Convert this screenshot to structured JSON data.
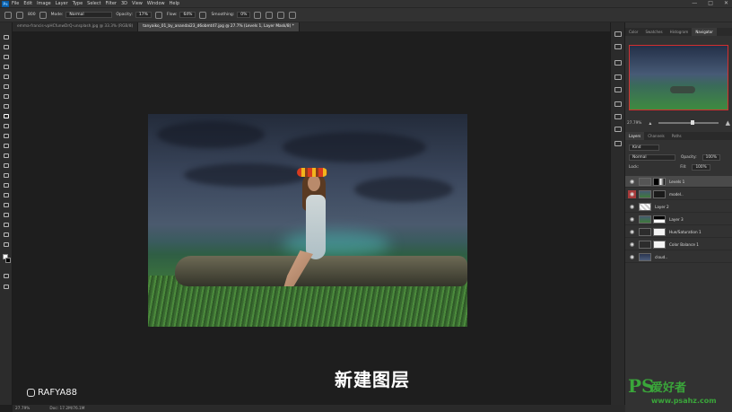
{
  "menubar": {
    "logo": "Ps",
    "items": [
      "File",
      "Edit",
      "Image",
      "Layer",
      "Type",
      "Select",
      "Filter",
      "3D",
      "View",
      "Window",
      "Help"
    ],
    "window_controls": [
      "—",
      "□",
      "✕"
    ]
  },
  "options": {
    "brush_size": "800",
    "mode_label": "Mode:",
    "mode_value": "Normal",
    "opacity_label": "Opacity:",
    "opacity_value": "17%",
    "flow_label": "Flow:",
    "flow_value": "64%",
    "smoothing_label": "Smoothing:",
    "smoothing_value": "0%"
  },
  "tabs": [
    {
      "label": "emma-francis-vpHCfunwDrQ-unsplash.jpg @ 33.3% (RGB/8)",
      "active": false
    },
    {
      "label": "tanyaiko_01_by_anandai23_d6obmt47.jpg @ 27.7% (Levels 1, Layer Mask/8) *",
      "active": true
    }
  ],
  "subtitle": "新建图层",
  "brand": {
    "handle": "RAFYA88"
  },
  "status": {
    "zoom": "27.79%",
    "doc": "Doc: 17.2M/76.1M"
  },
  "panels": {
    "top_tabs": [
      {
        "label": "Color",
        "active": false
      },
      {
        "label": "Swatches",
        "active": false
      },
      {
        "label": "Histogram",
        "active": false
      },
      {
        "label": "Navigator",
        "active": true
      }
    ],
    "nav_zoom": "27.79%",
    "layer_tabs": [
      {
        "label": "Layers",
        "active": true
      },
      {
        "label": "Channels",
        "active": false
      },
      {
        "label": "Paths",
        "active": false
      }
    ],
    "kind_label": "Kind",
    "blend_mode": "Normal",
    "opacity_label": "Opacity:",
    "opacity_value": "100%",
    "lock_label": "Lock:",
    "fill_label": "Fill:",
    "fill_value": "100%"
  },
  "layers": [
    {
      "name": "Levels 1",
      "selected": true,
      "visible_red": false
    },
    {
      "name": "model..",
      "selected": false,
      "visible_red": true
    },
    {
      "name": "Layer 2",
      "selected": false,
      "visible_red": false
    },
    {
      "name": "Layer 3",
      "selected": false,
      "visible_red": false
    },
    {
      "name": "Hue/Saturation 1",
      "selected": false,
      "visible_red": false
    },
    {
      "name": "Color Balance 1",
      "selected": false,
      "visible_red": false
    },
    {
      "name": "cloud..",
      "selected": false,
      "visible_red": false
    }
  ],
  "watermark": {
    "ps": "PS",
    "cn": "爱好者",
    "url": "www.psahz.com"
  },
  "colors": {
    "accent_red": "#d32f2f",
    "watermark_green": "#3aa63a",
    "ui_dark": "#323232"
  }
}
